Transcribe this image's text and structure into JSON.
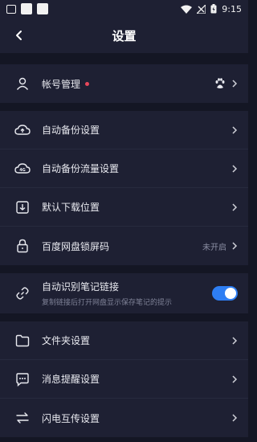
{
  "status_bar": {
    "time": "9:15"
  },
  "header": {
    "title": "设置"
  },
  "account": {
    "label": "帐号管理"
  },
  "group2": [
    {
      "label": "自动备份设置",
      "icon": "cloud-upload-icon"
    },
    {
      "label": "自动备份流量设置",
      "icon": "cloud-4g-icon"
    },
    {
      "label": "默认下载位置",
      "icon": "download-icon"
    },
    {
      "label": "百度网盘锁屏码",
      "icon": "lock-icon",
      "value": "未开启"
    }
  ],
  "link_recognition": {
    "label": "自动识别笔记链接",
    "sub": "复制链接后打开网盘显示保存笔记的提示",
    "enabled": true
  },
  "group4": [
    {
      "label": "文件夹设置",
      "icon": "folder-icon"
    },
    {
      "label": "消息提醒设置",
      "icon": "message-icon"
    },
    {
      "label": "闪电互传设置",
      "icon": "transfer-icon"
    }
  ],
  "colors": {
    "background": "#141624",
    "card": "#1e2033",
    "accent": "#2e7ef3",
    "badge": "#e8475b"
  }
}
